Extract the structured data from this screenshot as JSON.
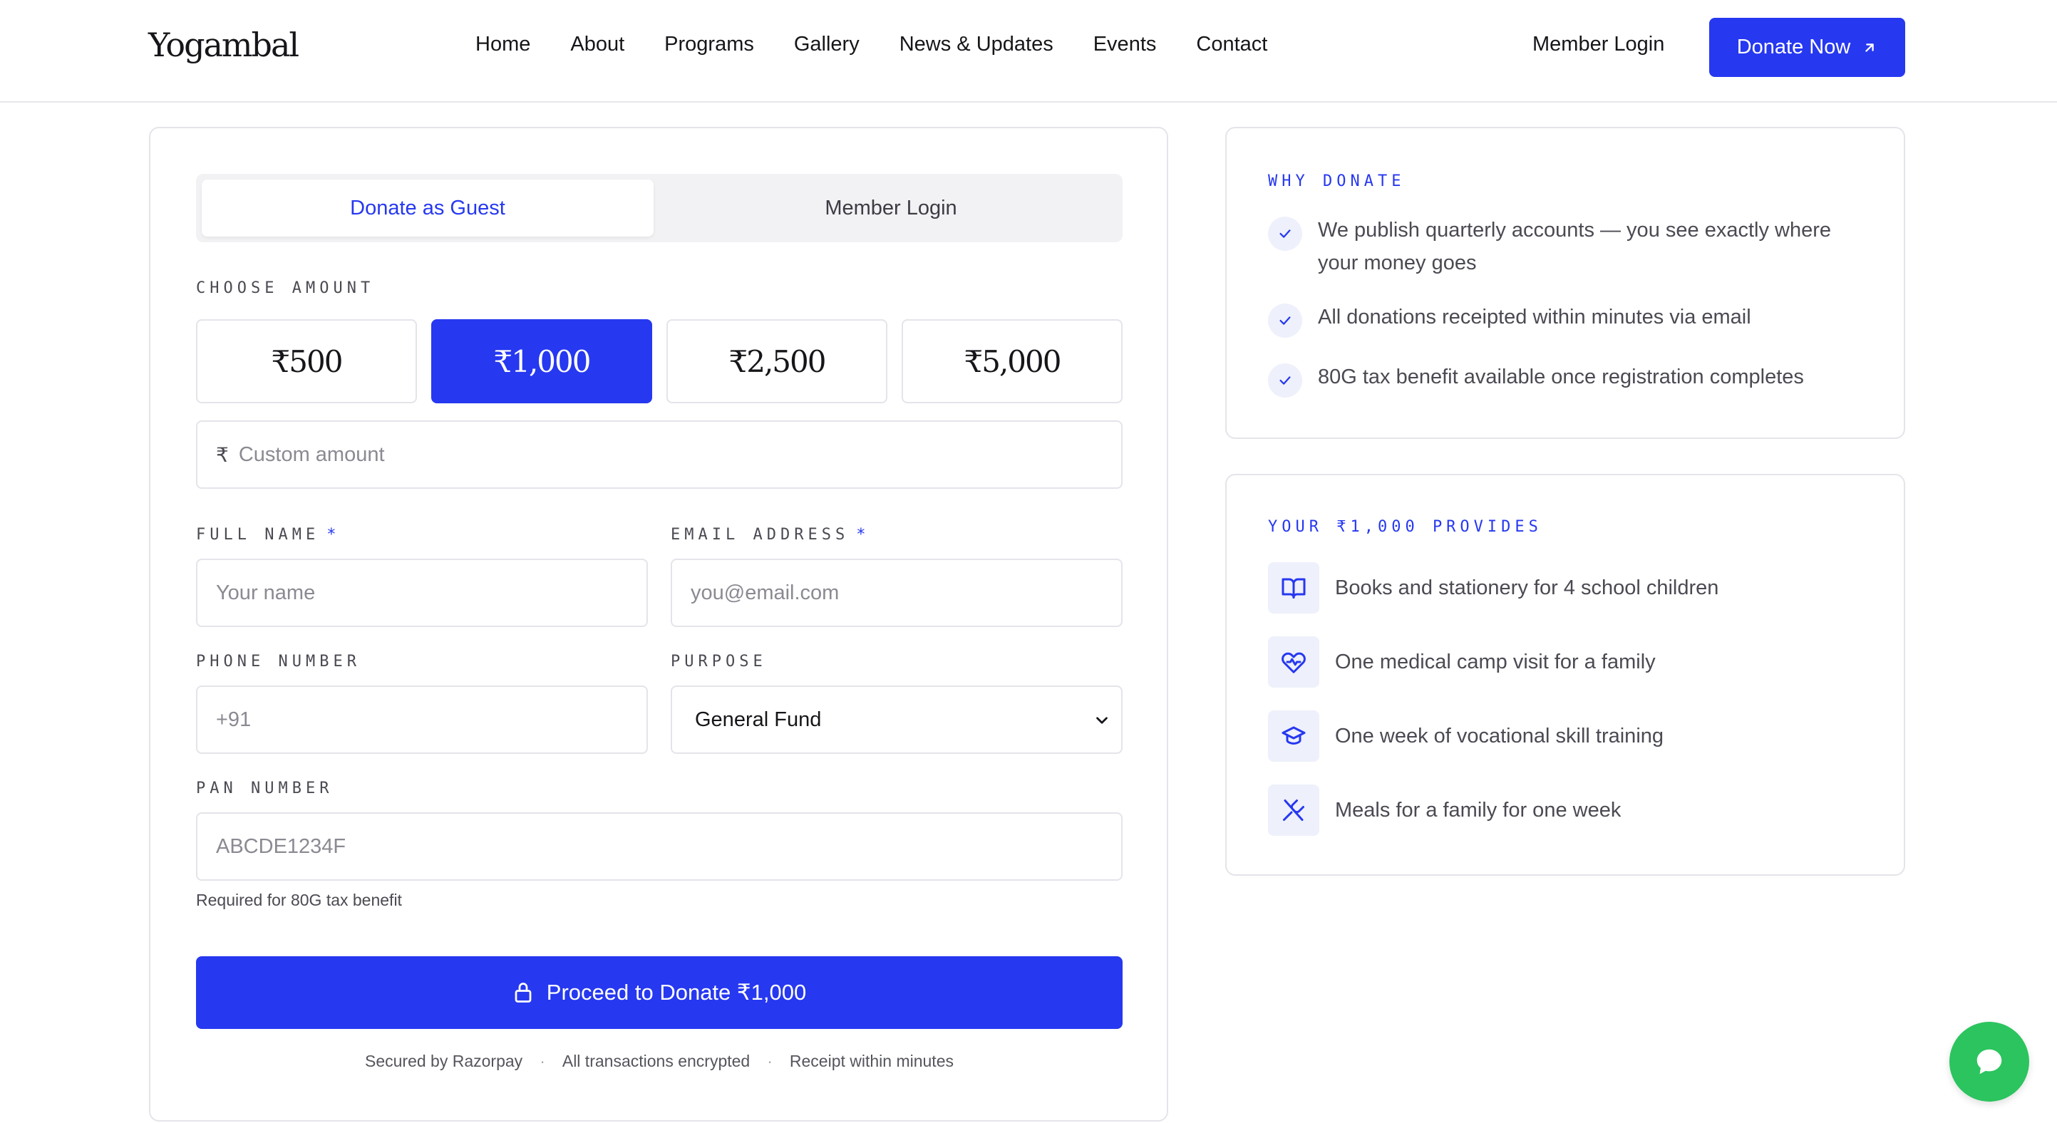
{
  "header": {
    "logo": "Yogambal",
    "nav": [
      "Home",
      "About",
      "Programs",
      "Gallery",
      "News & Updates",
      "Events",
      "Contact"
    ],
    "member_login": "Member Login",
    "donate_now": "Donate Now"
  },
  "form": {
    "tabs": {
      "guest": "Donate as Guest",
      "member": "Member Login",
      "active": "guest"
    },
    "choose_amount_label": "CHOOSE AMOUNT",
    "amounts": [
      "₹500",
      "₹1,000",
      "₹2,500",
      "₹5,000"
    ],
    "selected_amount": "₹1,000",
    "custom_amount": {
      "symbol": "₹",
      "placeholder": "Custom amount"
    },
    "full_name": {
      "label": "FULL NAME",
      "required_mark": "*",
      "placeholder": "Your name"
    },
    "email": {
      "label": "EMAIL ADDRESS",
      "required_mark": "*",
      "placeholder": "you@email.com"
    },
    "phone": {
      "label": "PHONE NUMBER",
      "placeholder": "+91"
    },
    "purpose": {
      "label": "PURPOSE",
      "value": "General Fund"
    },
    "pan": {
      "label": "PAN NUMBER",
      "placeholder": "ABCDE1234F",
      "helper": "Required for 80G tax benefit"
    },
    "proceed_button": "Proceed to Donate ₹1,000",
    "footer_notes": [
      "Secured by Razorpay",
      "All transactions encrypted",
      "Receipt within minutes"
    ]
  },
  "why_donate": {
    "title": "WHY DONATE",
    "items": [
      "We publish quarterly accounts — you see exactly where your money goes",
      "All donations receipted within minutes via email",
      "80G tax benefit available once registration completes"
    ]
  },
  "provides": {
    "title": "YOUR ₹1,000 PROVIDES",
    "items": [
      {
        "icon": "book-icon",
        "text": "Books and stationery for 4 school children"
      },
      {
        "icon": "heart-pulse-icon",
        "text": "One medical camp visit for a family"
      },
      {
        "icon": "graduation-cap-icon",
        "text": "One week of vocational skill training"
      },
      {
        "icon": "utensils-icon",
        "text": "Meals for a family for one week"
      }
    ]
  },
  "colors": {
    "accent": "#2638f0",
    "accent_soft": "#eef0fb",
    "chat": "#2bc45e",
    "border": "#e4e4ea"
  },
  "chat": {
    "icon": "chat-bubble-icon"
  }
}
